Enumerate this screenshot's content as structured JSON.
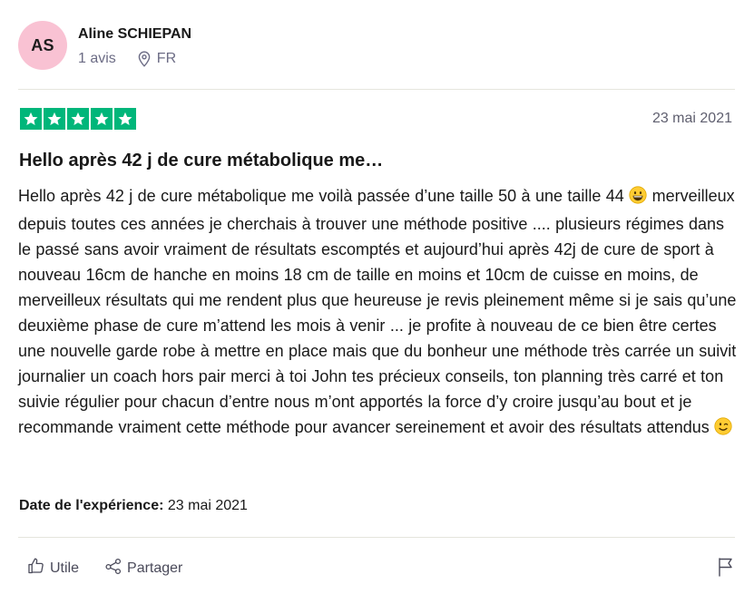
{
  "reviewer": {
    "initials": "AS",
    "name": "Aline SCHIEPAN",
    "review_count": "1 avis",
    "country": "FR",
    "avatar_color": "#f9c2d3"
  },
  "review": {
    "rating": 5,
    "star_color": "#00b67a",
    "date": "23 mai 2021",
    "title": "Hello après 42 j de cure métabolique me…",
    "body_part1": "Hello après 42 j de cure métabolique me voilà passée d’une taille 50 à une taille 44 ",
    "body_part2": " merveilleux depuis toutes ces années je cherchais à trouver une méthode positive .... plusieurs régimes dans le passé sans avoir vraiment de résultats escomptés et aujourd’hui après 42j de cure de sport à nouveau 16cm de hanche en moins 18 cm de taille en moins et 10cm de cuisse en moins, de merveilleux résultats qui me rendent plus que heureuse je revis pleinement même si je sais qu’une deuxième phase de cure m’attend les mois à venir ... je profite à nouveau de ce bien être certes une nouvelle garde robe à mettre en place mais que du bonheur une méthode très carrée un suivit journalier un coach hors pair merci à toi John tes précieux conseils, ton planning très carré et ton suivie régulier pour chacun d’entre nous m’ont apportés la force d’y croire jusqu’au bout et je recommande vraiment cette méthode pour avancer sereinement et avoir des résultats attendus ",
    "experience_label": "Date de l'expérience:",
    "experience_date": "23 mai 2021"
  },
  "actions": {
    "useful_label": "Utile",
    "share_label": "Partager"
  },
  "icons": {
    "location": "location-pin-icon",
    "star": "star-icon",
    "emoji_grin": "grinning-face-emoji",
    "emoji_wink": "winking-face-emoji",
    "thumbs_up": "thumbs-up-icon",
    "share": "share-icon",
    "flag": "flag-icon"
  }
}
